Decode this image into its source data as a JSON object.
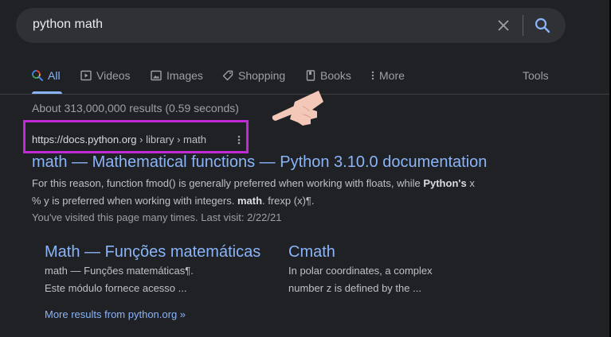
{
  "search": {
    "query": "python math"
  },
  "tabs": [
    {
      "label": "All",
      "active": true
    },
    {
      "label": "Videos"
    },
    {
      "label": "Images"
    },
    {
      "label": "Shopping"
    },
    {
      "label": "Books"
    },
    {
      "label": "More"
    }
  ],
  "tools_label": "Tools",
  "stats": "About 313,000,000 results (0.59 seconds)",
  "result": {
    "url_domain": "https://docs.python.org",
    "url_path": " › library › math",
    "title": "math — Mathematical functions — Python 3.10.0 documentation",
    "snippet1_a": "For this reason, function fmod() is generally preferred when working with floats, while ",
    "snippet1_b": "Python's",
    "snippet1_c": " x",
    "snippet2_a": "% y is preferred when working with integers. ",
    "snippet2_b": "math",
    "snippet2_c": ". frexp (x)¶.",
    "visited": "You've visited this page many times. Last visit: 2/22/21"
  },
  "sitelinks": [
    {
      "title": "Math — Funções matemáticas",
      "line1": "math — Funções matemáticas¶.",
      "line2": "Este módulo fornece acesso ..."
    },
    {
      "title": "Cmath",
      "line1": "In polar coordinates, a complex",
      "line2": "number z is defined by the ..."
    }
  ],
  "more_results": "More results from python.org »",
  "colors": {
    "background": "#202124",
    "link": "#8ab4f8",
    "highlight": "#c128d6"
  }
}
